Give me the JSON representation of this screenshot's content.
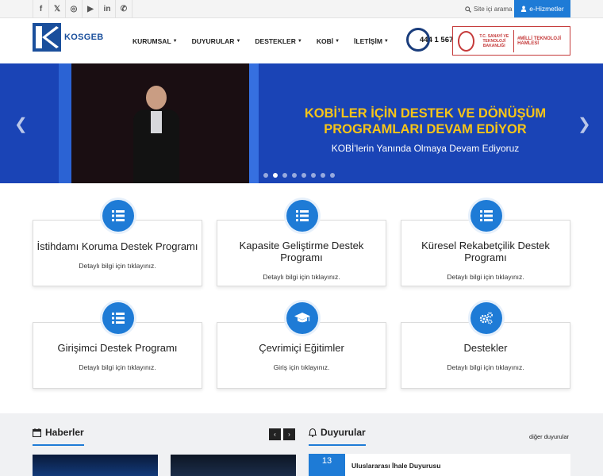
{
  "topbar": {
    "social": [
      {
        "icon": "facebook-icon",
        "glyph": "f"
      },
      {
        "icon": "x-twitter-icon",
        "glyph": "𝕏"
      },
      {
        "icon": "instagram-icon",
        "glyph": "◎"
      },
      {
        "icon": "youtube-icon",
        "glyph": "▶"
      },
      {
        "icon": "linkedin-icon",
        "glyph": "in"
      },
      {
        "icon": "phone-icon",
        "glyph": "✆"
      }
    ],
    "search_label": "Site içi arama",
    "ehizmetler_label": "e-Hizmetler"
  },
  "header": {
    "logo_text": "KOSGEB",
    "nav": [
      "KURUMSAL",
      "DUYURULAR",
      "DESTEKLER",
      "KOBİ",
      "İLETİŞİM"
    ],
    "phone": "444 1 567",
    "ministry_text": "T.C. SANAYİ VE TEKNOLOJİ BAKANLIĞI",
    "milli_text": "#MİLLİ TEKNOLOJİ HAMLESİ"
  },
  "hero": {
    "headline": "KOBİ’LER İÇİN DESTEK VE DÖNÜŞÜM PROGRAMLARI DEVAM EDİYOR",
    "subline": "KOBİ'lerin Yanında Olmaya Devam Ediyoruz",
    "slide_count": 8,
    "active_slide": 2
  },
  "cards": [
    {
      "title": "İstihdamı Koruma Destek Programı",
      "subtitle": "Detaylı bilgi için tıklayınız.",
      "icon": "list-icon"
    },
    {
      "title": "Kapasite Geliştirme Destek Programı",
      "subtitle": "Detaylı bilgi için tıklayınız.",
      "icon": "list-icon"
    },
    {
      "title": "Küresel Rekabetçilik Destek Programı",
      "subtitle": "Detaylı bilgi için tıklayınız.",
      "icon": "list-icon"
    },
    {
      "title": "Girişimci Destek Programı",
      "subtitle": "Detaylı bilgi için tıklayınız.",
      "icon": "list-icon"
    },
    {
      "title": "Çevrimiçi Eğitimler",
      "subtitle": "Giriş için tıklayınız.",
      "icon": "graduation-cap-icon"
    },
    {
      "title": "Destekler",
      "subtitle": "Detaylı bilgi için tıklayınız.",
      "icon": "gears-icon"
    }
  ],
  "news": {
    "title": "Haberler",
    "prev": "‹",
    "next": "›"
  },
  "announcements": {
    "title": "Duyurular",
    "more_label": "diğer duyurular",
    "items": [
      {
        "date": "13",
        "title": "Uluslararası İhale Duyurusu"
      }
    ]
  },
  "colors": {
    "primary": "#1e7bd6",
    "hero_bg": "#1a44b6",
    "hero_headline": "#f7c518",
    "brand": "#1a4f9c"
  }
}
